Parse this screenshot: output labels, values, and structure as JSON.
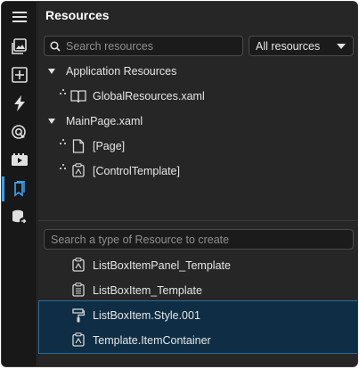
{
  "panel": {
    "title": "Resources"
  },
  "rail": {
    "items": [
      {
        "icon": "menu-icon",
        "active": false
      },
      {
        "icon": "assets-icon",
        "active": false
      },
      {
        "icon": "add-box-icon",
        "active": false
      },
      {
        "icon": "lightning-icon",
        "active": false
      },
      {
        "icon": "target-icon",
        "active": false
      },
      {
        "icon": "media-icon",
        "active": false
      },
      {
        "icon": "resources-icon",
        "active": true
      },
      {
        "icon": "data-icon",
        "active": false
      }
    ],
    "accent": "#3aa0f0"
  },
  "search": {
    "placeholder": "Search resources"
  },
  "filter": {
    "selected": "All resources"
  },
  "tree": {
    "groups": [
      {
        "label": "Application Resources",
        "children": [
          {
            "label": "GlobalResources.xaml",
            "icon": "book-icon"
          }
        ]
      },
      {
        "label": "MainPage.xaml",
        "children": [
          {
            "label": "[Page]",
            "icon": "page-icon"
          },
          {
            "label": "[ControlTemplate]",
            "icon": "template-icon"
          }
        ]
      }
    ]
  },
  "create": {
    "placeholder": "Search a type of Resource to create"
  },
  "resource_types": [
    {
      "label": "ListBoxItemPanel_Template",
      "icon": "template-icon",
      "selected": false
    },
    {
      "label": "ListBoxItem_Template",
      "icon": "template-list-icon",
      "selected": false
    },
    {
      "label": "ListBoxItem.Style.001",
      "icon": "style-brush-icon",
      "selected": true
    },
    {
      "label": "Template.ItemContainer",
      "icon": "template-icon",
      "selected": true
    }
  ],
  "colors": {
    "selection_bg": "#0f2e45",
    "selection_border": "#2c6a96"
  }
}
